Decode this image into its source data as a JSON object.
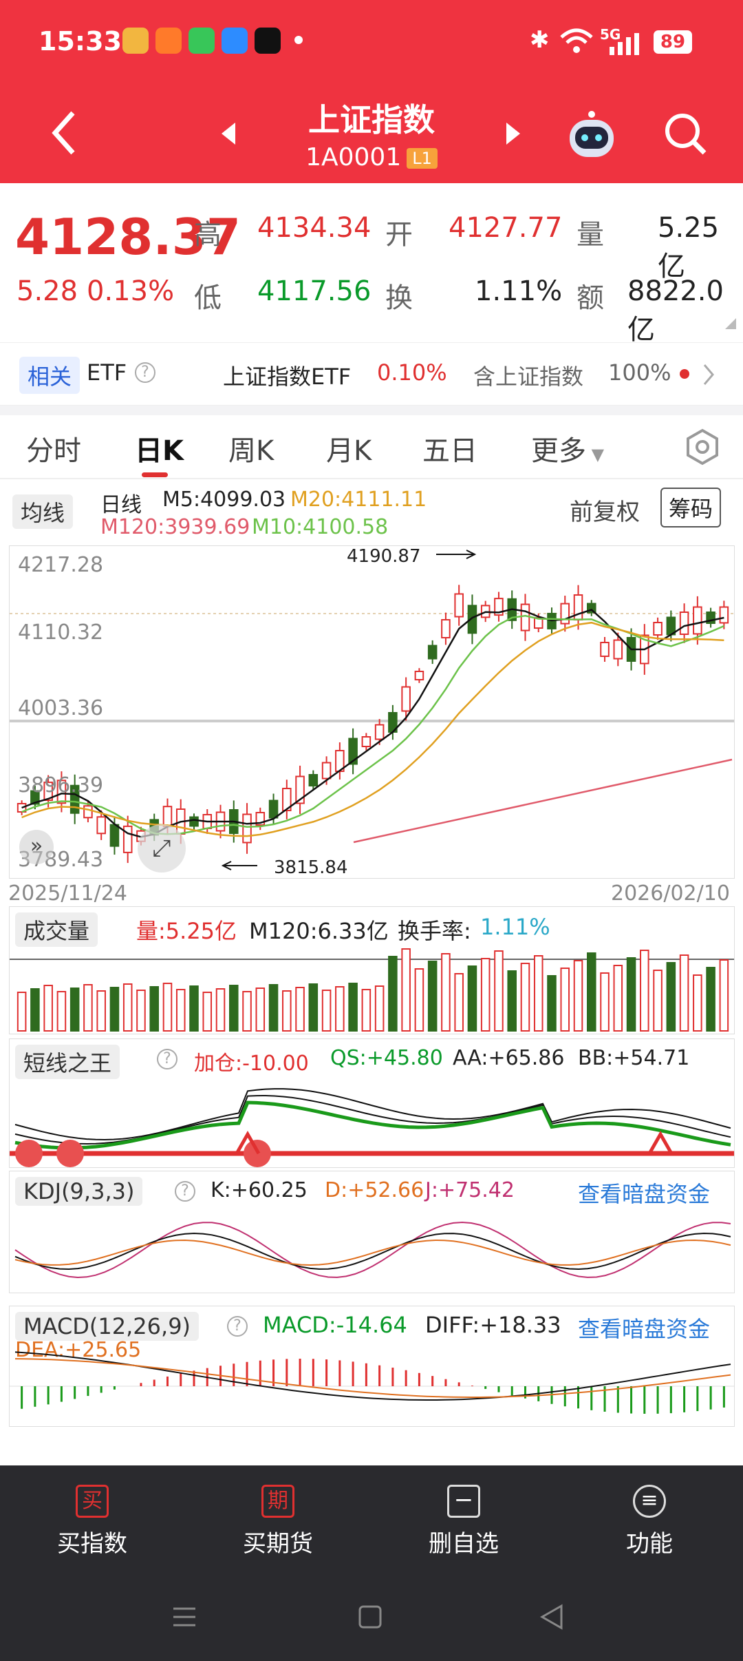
{
  "status": {
    "time": "15:33",
    "network": "5G",
    "battery": "89"
  },
  "header": {
    "title": "上证指数",
    "code": "1A0001",
    "level": "L1"
  },
  "quote": {
    "price": "4128.37",
    "change": "5.28",
    "change_pct": "0.13%",
    "high_label": "高",
    "high": "4134.34",
    "open_label": "开",
    "open": "4127.77",
    "vol_label": "量",
    "vol": "5.25亿",
    "low_label": "低",
    "low": "4117.56",
    "turn_label": "换",
    "turn": "1.11%",
    "amt_label": "额",
    "amt": "8822.0亿"
  },
  "etf": {
    "tag": "相关",
    "etf": "ETF",
    "name": "上证指数ETF",
    "pct": "0.10%",
    "hold": "含上证指数",
    "hold_pct": "100%"
  },
  "tabs": [
    "分时",
    "日K",
    "周K",
    "月K",
    "五日",
    "更多"
  ],
  "kline": {
    "ma_dd": "均线",
    "period": "日线",
    "m5": "M5:4099.03",
    "m20": "M20:4111.11",
    "m120": "M120:3939.69",
    "m10": "M10:4100.58",
    "fuquan": "前复权",
    "chouma": "筹码",
    "y_ticks": [
      "4217.28",
      "4110.32",
      "4003.36",
      "3896.39",
      "3789.43"
    ],
    "max_label": "4190.87",
    "min_label": "3815.84",
    "date_start": "2025/11/24",
    "date_end": "2026/02/10"
  },
  "volume": {
    "dd": "成交量",
    "vol": "量:5.25亿",
    "m120": "M120:6.33亿",
    "turn_label": "换手率:",
    "turn": "1.11%"
  },
  "dxzw": {
    "dd": "短线之王",
    "jc": "加仓:-10.00",
    "qs": "QS:+45.80",
    "aa": "AA:+65.86",
    "bb": "BB:+54.71"
  },
  "kdj": {
    "dd": "KDJ(9,3,3)",
    "k": "K:+60.25",
    "d": "D:+52.66",
    "j": "J:+75.42",
    "link": "查看暗盘资金"
  },
  "macd": {
    "dd": "MACD(12,26,9)",
    "macd": "MACD:-14.64",
    "diff": "DIFF:+18.33",
    "dea": "DEA:+25.65",
    "link": "查看暗盘资金"
  },
  "nav": [
    "买指数",
    "买期货",
    "删自选",
    "功能"
  ],
  "colors": {
    "brand": "#ef3340",
    "up": "#e03030",
    "down": "#2f6b1f",
    "ma5": "#111111",
    "ma10": "#6cc24a",
    "ma20": "#e0a020",
    "ma120": "#e05a6a"
  }
}
